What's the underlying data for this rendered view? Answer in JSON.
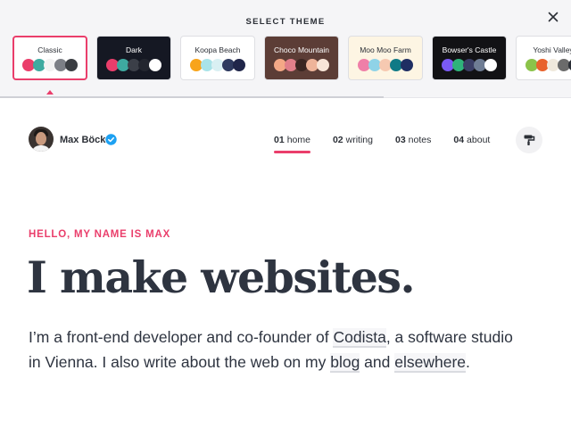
{
  "theme_picker": {
    "title": "SELECT THEME",
    "themes": [
      {
        "name": "Classic",
        "bg": "#ffffff",
        "text": "#2b2f36",
        "selected": true,
        "swatches": [
          "#ea3e6b",
          "#3eaaa0",
          "#f2f2f2",
          "#7c7f86",
          "#3a3d42"
        ]
      },
      {
        "name": "Dark",
        "bg": "#151823",
        "text": "#ffffff",
        "selected": false,
        "swatches": [
          "#ea3e6b",
          "#3eaaa0",
          "#3b3f48",
          "#23262f",
          "#ffffff"
        ]
      },
      {
        "name": "Koopa Beach",
        "bg": "#ffffff",
        "text": "#2b2f36",
        "selected": false,
        "swatches": [
          "#f8a41b",
          "#a9e3e8",
          "#d9f0f3",
          "#2e3a5f",
          "#20264a"
        ]
      },
      {
        "name": "Choco Mountain",
        "bg": "#5c3d36",
        "text": "#ffffff",
        "selected": false,
        "swatches": [
          "#f4a886",
          "#e07f8a",
          "#3a2622",
          "#eeb49a",
          "#f8e5d8"
        ]
      },
      {
        "name": "Moo Moo Farm",
        "bg": "#fdf5e3",
        "text": "#2b2f36",
        "selected": false,
        "swatches": [
          "#ef7fa8",
          "#8fd3e7",
          "#f6c9b1",
          "#0f7a86",
          "#1f2e63"
        ]
      },
      {
        "name": "Bowser's Castle",
        "bg": "#121215",
        "text": "#ffffff",
        "selected": false,
        "swatches": [
          "#7a5af5",
          "#2fb37b",
          "#3b3f66",
          "#6f7d94",
          "#ffffff"
        ]
      },
      {
        "name": "Yoshi Valley",
        "bg": "#ffffff",
        "text": "#2b2f36",
        "selected": false,
        "swatches": [
          "#8bc34a",
          "#e8622c",
          "#f0e9dc",
          "#6b6b6b",
          "#2b2f36"
        ]
      }
    ]
  },
  "header": {
    "site_name": "Max Böck",
    "nav": [
      {
        "num": "01",
        "label": "home",
        "active": true
      },
      {
        "num": "02",
        "label": "writing",
        "active": false
      },
      {
        "num": "03",
        "label": "notes",
        "active": false
      },
      {
        "num": "04",
        "label": "about",
        "active": false
      }
    ]
  },
  "hero": {
    "eyebrow": "HELLO, MY NAME IS MAX",
    "headline": "I make websites.",
    "intro_before": "I’m a front-end developer and co-founder of ",
    "link_codista": "Codista",
    "intro_middle": ", a software studio in Vienna. I also write about the web on my ",
    "link_blog": "blog",
    "intro_and": " and ",
    "link_elsewhere": "elsewhere",
    "intro_end": "."
  },
  "colors": {
    "accent": "#ea3e6b",
    "text": "#2e3440",
    "panel_bg": "#f5f5f7"
  }
}
